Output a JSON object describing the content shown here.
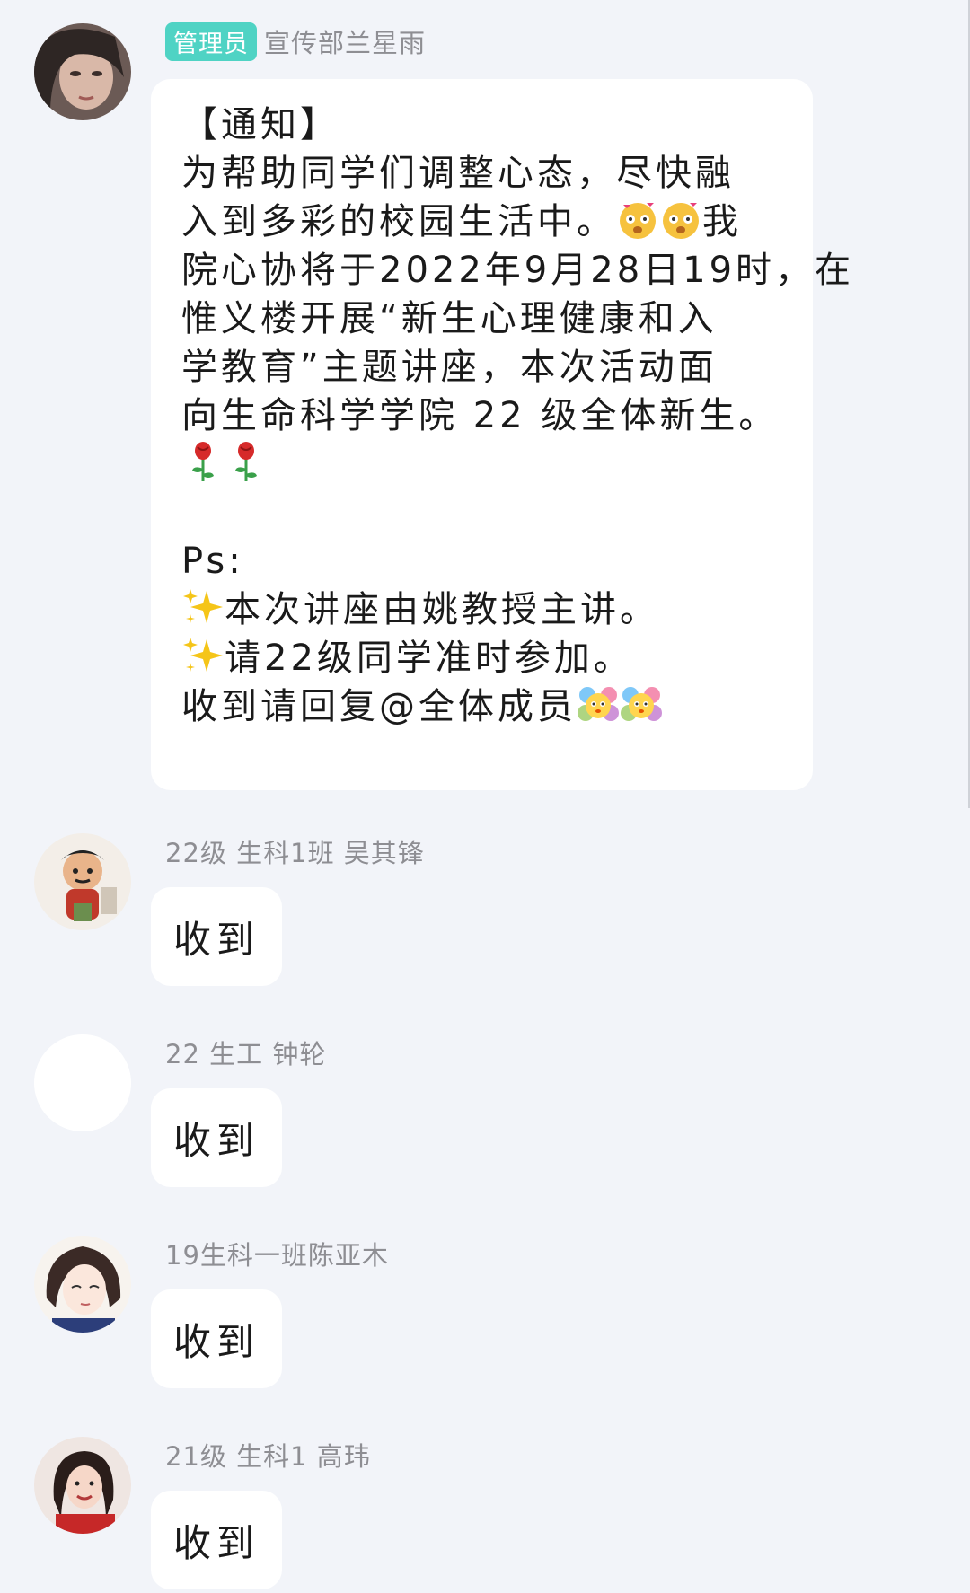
{
  "messages": [
    {
      "role_badge": "管理员",
      "sender": "宣传部兰星雨",
      "avatar": "woman-portrait-avatar",
      "lines": [
        "【通知】",
        "为帮助同学们调整心态，尽快融",
        "入到多彩的校园生活中。",
        "院心协将于2022年9月28日19时，在",
        "惟义楼开展“新生心理健康和入",
        "学教育”主题讲座，本次活动面",
        "向生命科学学院 22 级全体新生。",
        "",
        "",
        "Ps:",
        "本次讲座由姚教授主讲。",
        "请22级同学准时参加。",
        "收到请回复@全体成员"
      ],
      "inline_after_line3": "我",
      "emoji": [
        "blushing-face-emoji",
        "rose-emoji",
        "sparkles-emoji",
        "flower-face-emoji"
      ]
    },
    {
      "sender": "22级 生科1班 吴其锋",
      "text": "收到",
      "avatar": "cartoon-warrior-avatar"
    },
    {
      "sender": "22 生工 钟轮",
      "text": "收到",
      "avatar": "blank-avatar"
    },
    {
      "sender": "19生科一班陈亚木",
      "text": "收到",
      "avatar": "anime-girl-avatar"
    },
    {
      "sender": "21级 生科1 高玮",
      "text": "收到",
      "avatar": "smiling-girl-avatar"
    }
  ]
}
